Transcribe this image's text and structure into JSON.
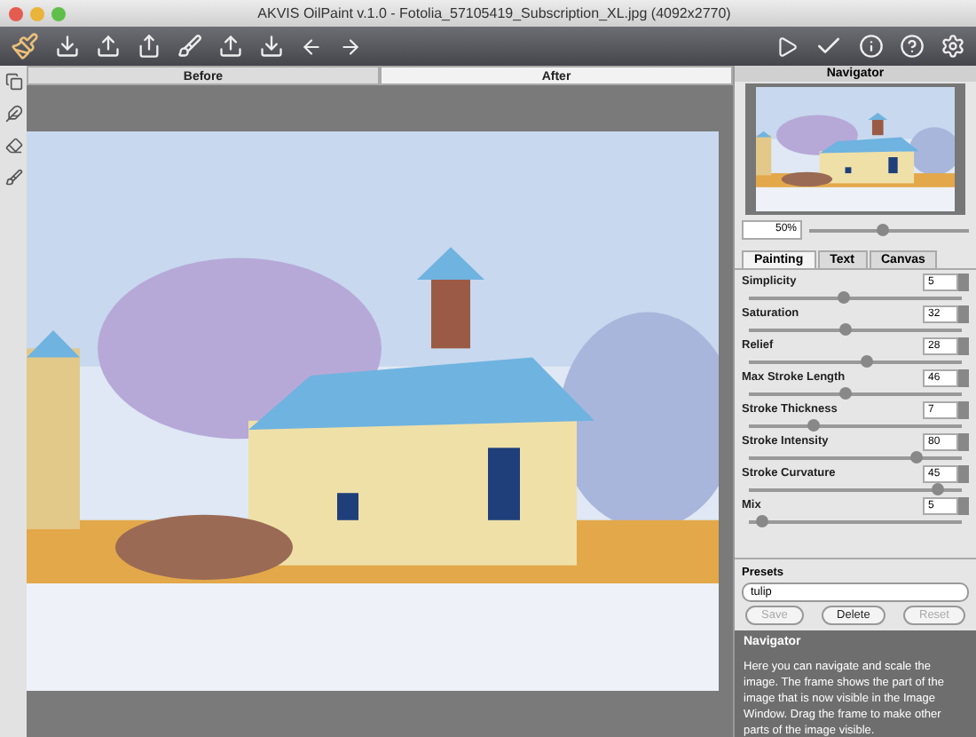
{
  "window": {
    "title": "AKVIS OilPaint v.1.0 - Fotolia_57105419_Subscription_XL.jpg (4092x2770)"
  },
  "view_tabs": [
    {
      "label": "Before",
      "selected": false
    },
    {
      "label": "After",
      "selected": true
    }
  ],
  "navigator": {
    "title": "Navigator",
    "zoom": "50%",
    "level": 0.45
  },
  "settings_tabs": [
    {
      "label": "Painting",
      "selected": true
    },
    {
      "label": "Text",
      "selected": false
    },
    {
      "label": "Canvas",
      "selected": false
    }
  ],
  "parameters": [
    {
      "name": "Simplicity",
      "value": "5",
      "level": 0.44
    },
    {
      "name": "Saturation",
      "value": "32",
      "level": 0.45
    },
    {
      "name": "Relief",
      "value": "28",
      "level": 0.55
    },
    {
      "name": "Max Stroke Length",
      "value": "46",
      "level": 0.45
    },
    {
      "name": "Stroke Thickness",
      "value": "7",
      "level": 0.3
    },
    {
      "name": "Stroke Intensity",
      "value": "80",
      "level": 0.78
    },
    {
      "name": "Stroke Curvature",
      "value": "45",
      "level": 0.88
    },
    {
      "name": "Mix",
      "value": "5",
      "level": 0.06
    }
  ],
  "presets": {
    "label": "Presets",
    "value": "tulip",
    "buttons": [
      {
        "label": "Save",
        "disabled": true
      },
      {
        "label": "Delete",
        "disabled": false
      },
      {
        "label": "Reset",
        "disabled": true
      }
    ]
  },
  "help": {
    "title": "Navigator",
    "text": "Here you can navigate and scale the image. The frame shows the part of the image that is now visible in the Image Window. Drag the frame to make other parts of the image visible."
  }
}
